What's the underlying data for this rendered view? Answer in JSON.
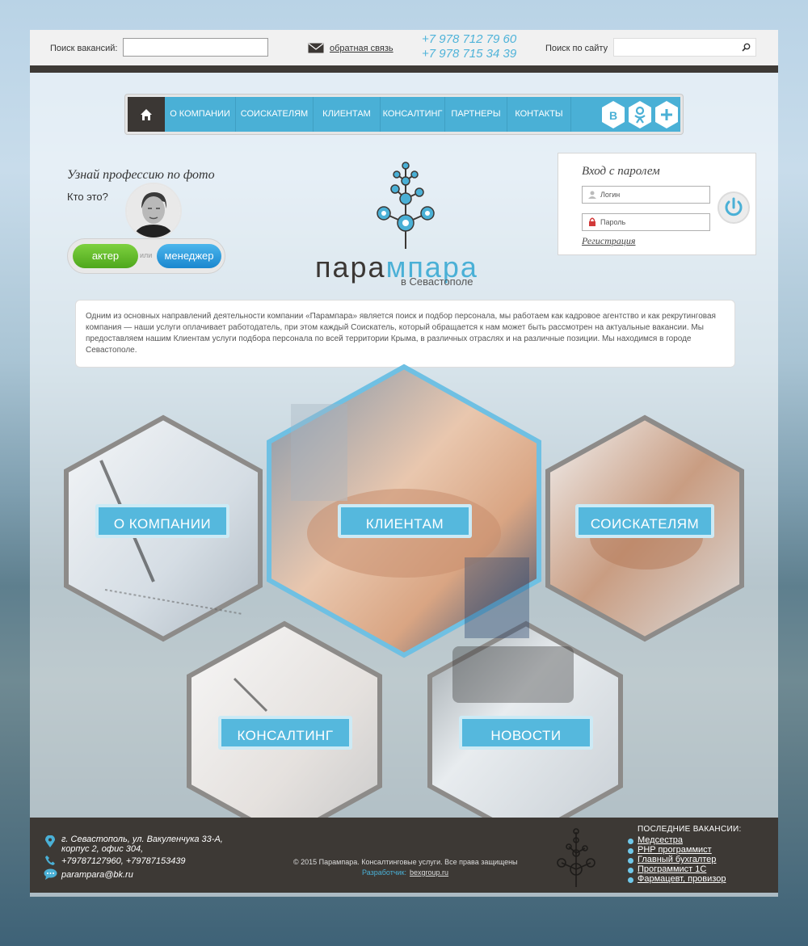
{
  "header": {
    "vacancy_search_label": "Поиск вакансий:",
    "vacancy_search_value": "",
    "feedback_link": "обратная связь",
    "phone_1": "+7 978 712 79 60",
    "phone_2": "+7 978 715 34 39",
    "site_search_label": "Поиск по сайту",
    "site_search_value": ""
  },
  "nav": {
    "items": [
      {
        "label": "О КОМПАНИИ"
      },
      {
        "label": "СОИСКАТЕЛЯМ"
      },
      {
        "label": "КЛИЕНТАМ"
      },
      {
        "label": "КОНСАЛТИНГ"
      },
      {
        "label": "ПАРТНЕРЫ"
      },
      {
        "label": "КОНТАКТЫ"
      }
    ],
    "social": [
      "В",
      "ok",
      "+"
    ]
  },
  "quiz": {
    "title": "Узнай профессию по фото",
    "question": "Кто это?",
    "option_1": "актер",
    "separator": "или",
    "option_2": "менеджер"
  },
  "logo": {
    "part_1": "пара",
    "part_2": "мпара",
    "subtitle": "в Севастополе"
  },
  "login": {
    "title": "Вход с паролем",
    "login_placeholder": "Логин",
    "password_placeholder": "Пароль",
    "register_link": "Регистрация"
  },
  "description": "Одним из основных направлений деятельности компании «Парампара» является поиск и подбор персонала, мы работаем как кадровое агентство и как рекрутинговая компания — наши услуги оплачивает работодатель, при этом каждый Соискатель, который обращается к нам может быть рассмотрен на актуальные вакансии. Мы предоставляем нашим Клиентам услуги подбора персонала по всей территории Крыма, в различных отраслях и на различные позиции. Мы находимся в городе Севастополе.",
  "tiles": [
    {
      "label": "О КОМПАНИИ"
    },
    {
      "label": "КЛИЕНТАМ"
    },
    {
      "label": "СОИСКАТЕЛЯМ"
    },
    {
      "label": "КОНСАЛТИНГ"
    },
    {
      "label": "НОВОСТИ"
    }
  ],
  "footer": {
    "address_1": "г. Севастополь, ул. Вакуленчука 33-А,",
    "address_2": "корпус 2, офис 304,",
    "phones": "+79787127960, +79787153439",
    "email": "parampara@bk.ru",
    "copyright": "© 2015 Парампара. Консалтинговые услуги. Все права защищены",
    "developer_label": "Разработчик:",
    "developer_link": "bexgroup.ru",
    "vacancies_title": "ПОСЛЕДНИЕ ВАКАНСИИ:",
    "vacancies": [
      "Медсестра",
      "PHP программист",
      "Главный бухгалтер",
      "Программист 1С",
      "Фармацевт, провизор"
    ]
  },
  "colors": {
    "accent": "#4ab0d6",
    "dark": "#3d3935",
    "green": "#5cb82a"
  }
}
